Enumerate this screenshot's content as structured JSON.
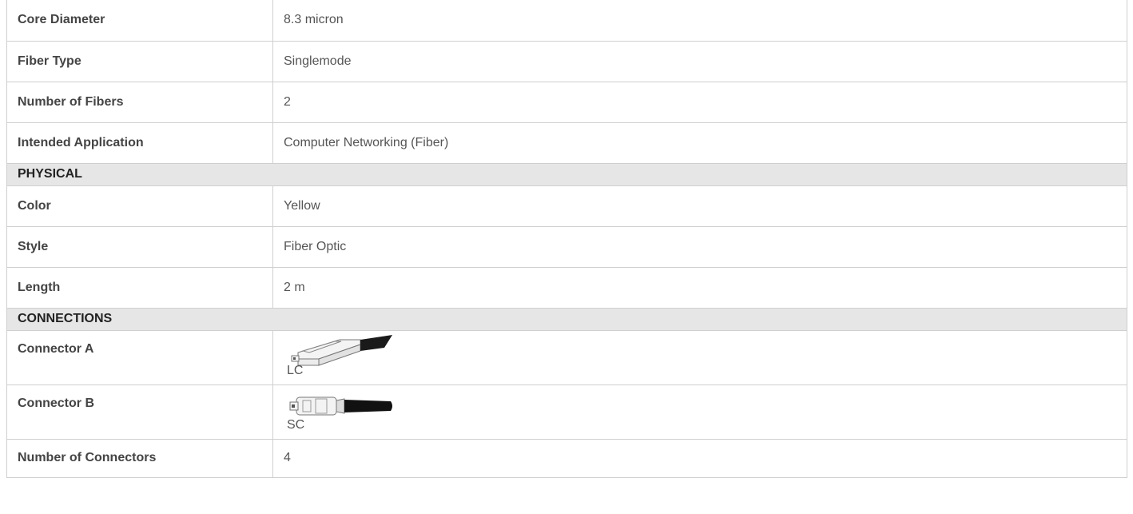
{
  "specs": {
    "rows_top": [
      {
        "label": "Core Diameter",
        "value": "8.3 micron"
      },
      {
        "label": "Fiber Type",
        "value": "Singlemode"
      },
      {
        "label": "Number of Fibers",
        "value": "2"
      },
      {
        "label": "Intended Application",
        "value": "Computer Networking (Fiber)"
      }
    ],
    "physical": {
      "heading": "PHYSICAL",
      "rows": [
        {
          "label": "Color",
          "value": "Yellow"
        },
        {
          "label": "Style",
          "value": "Fiber Optic"
        },
        {
          "label": "Length",
          "value": "2 m"
        }
      ]
    },
    "connections": {
      "heading": "CONNECTIONS",
      "connector_a": {
        "label": "Connector A",
        "type": "LC",
        "icon": "lc-connector-icon"
      },
      "connector_b": {
        "label": "Connector B",
        "type": "SC",
        "icon": "sc-connector-icon"
      },
      "count": {
        "label": "Number of Connectors",
        "value": "4"
      }
    }
  },
  "colors": {
    "border": "#cfcfcf",
    "section_bg": "#e6e6e6",
    "label_text": "#444444",
    "value_text": "#555555"
  }
}
